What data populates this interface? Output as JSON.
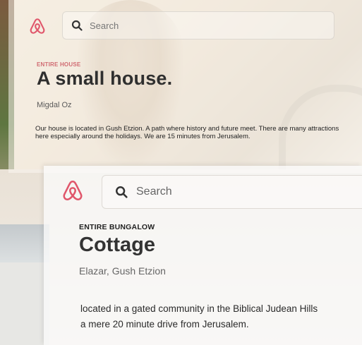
{
  "back_listing": {
    "search_placeholder": "Search",
    "property_type": "ENTIRE HOUSE",
    "title": "A small house.",
    "location": "Migdal Oz",
    "description": "Our house is located in Gush Etzion. A path where history and future meet. There are many attractions here especially around the holidays. We are 15 minutes from Jerusalem."
  },
  "front_listing": {
    "search_placeholder": "Search",
    "property_type": "ENTIRE BUNGALOW",
    "title": "Cottage",
    "location": "Elazar, Gush Etzion",
    "description_line1": "located in a gated community in the Biblical Judean Hills",
    "description_line2": "a mere 20 minute drive from Jerusalem."
  },
  "colors": {
    "brand": "#e0566b",
    "eyebrow": "#c44a57"
  },
  "icons": {
    "logo": "airbnb-logo-icon",
    "search": "search-icon"
  }
}
